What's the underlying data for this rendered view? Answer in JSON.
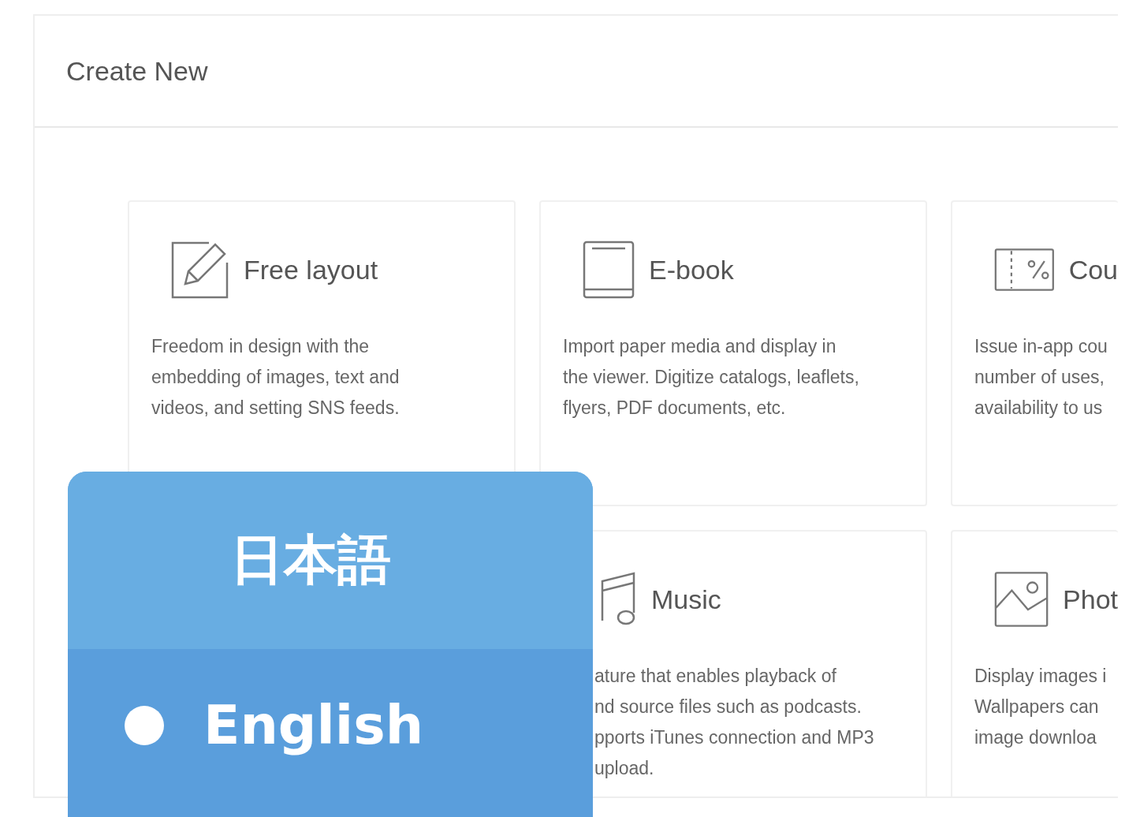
{
  "panel": {
    "title": "Create New"
  },
  "card_rows": [
    [
      {
        "kind": "pencil",
        "title": "Free layout",
        "description": [
          "Freedom in design with the",
          "embedding of images, text and",
          "videos, and setting SNS feeds."
        ]
      },
      {
        "kind": "book",
        "title": "E-book",
        "description": [
          "Import paper media and display in",
          "the viewer. Digitize catalogs, leaflets,",
          "flyers, PDF documents, etc."
        ]
      },
      {
        "kind": "coupon",
        "title": "Cou",
        "description": [
          "Issue in-app cou",
          "number of uses,",
          "availability to us"
        ]
      }
    ],
    [
      {
        "kind": "music",
        "title": "Music",
        "description": [
          "ature that enables playback of",
          "nd source files such as podcasts.",
          "pports iTunes connection and MP3",
          "upload."
        ]
      },
      {
        "kind": "photo",
        "title": "Phot",
        "description": [
          "Display images i",
          "Wallpapers can",
          "image downloa"
        ]
      }
    ]
  ],
  "language_menu": {
    "options": [
      {
        "label": "日本語",
        "selected": false
      },
      {
        "label": "English",
        "selected": true
      }
    ]
  }
}
